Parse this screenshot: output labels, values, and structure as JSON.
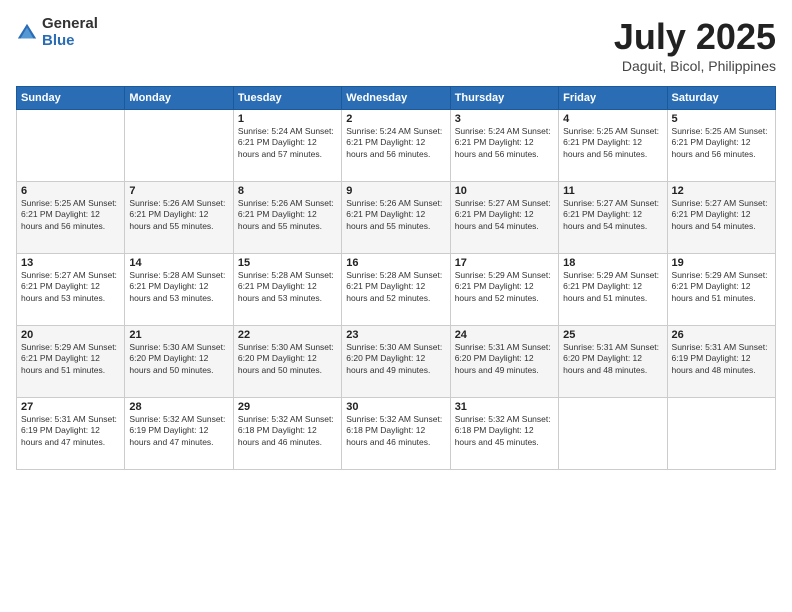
{
  "logo": {
    "general": "General",
    "blue": "Blue"
  },
  "title": "July 2025",
  "location": "Daguit, Bicol, Philippines",
  "days_header": [
    "Sunday",
    "Monday",
    "Tuesday",
    "Wednesday",
    "Thursday",
    "Friday",
    "Saturday"
  ],
  "weeks": [
    [
      {
        "day": "",
        "content": ""
      },
      {
        "day": "",
        "content": ""
      },
      {
        "day": "1",
        "content": "Sunrise: 5:24 AM\nSunset: 6:21 PM\nDaylight: 12 hours and 57 minutes."
      },
      {
        "day": "2",
        "content": "Sunrise: 5:24 AM\nSunset: 6:21 PM\nDaylight: 12 hours and 56 minutes."
      },
      {
        "day": "3",
        "content": "Sunrise: 5:24 AM\nSunset: 6:21 PM\nDaylight: 12 hours and 56 minutes."
      },
      {
        "day": "4",
        "content": "Sunrise: 5:25 AM\nSunset: 6:21 PM\nDaylight: 12 hours and 56 minutes."
      },
      {
        "day": "5",
        "content": "Sunrise: 5:25 AM\nSunset: 6:21 PM\nDaylight: 12 hours and 56 minutes."
      }
    ],
    [
      {
        "day": "6",
        "content": "Sunrise: 5:25 AM\nSunset: 6:21 PM\nDaylight: 12 hours and 56 minutes."
      },
      {
        "day": "7",
        "content": "Sunrise: 5:26 AM\nSunset: 6:21 PM\nDaylight: 12 hours and 55 minutes."
      },
      {
        "day": "8",
        "content": "Sunrise: 5:26 AM\nSunset: 6:21 PM\nDaylight: 12 hours and 55 minutes."
      },
      {
        "day": "9",
        "content": "Sunrise: 5:26 AM\nSunset: 6:21 PM\nDaylight: 12 hours and 55 minutes."
      },
      {
        "day": "10",
        "content": "Sunrise: 5:27 AM\nSunset: 6:21 PM\nDaylight: 12 hours and 54 minutes."
      },
      {
        "day": "11",
        "content": "Sunrise: 5:27 AM\nSunset: 6:21 PM\nDaylight: 12 hours and 54 minutes."
      },
      {
        "day": "12",
        "content": "Sunrise: 5:27 AM\nSunset: 6:21 PM\nDaylight: 12 hours and 54 minutes."
      }
    ],
    [
      {
        "day": "13",
        "content": "Sunrise: 5:27 AM\nSunset: 6:21 PM\nDaylight: 12 hours and 53 minutes."
      },
      {
        "day": "14",
        "content": "Sunrise: 5:28 AM\nSunset: 6:21 PM\nDaylight: 12 hours and 53 minutes."
      },
      {
        "day": "15",
        "content": "Sunrise: 5:28 AM\nSunset: 6:21 PM\nDaylight: 12 hours and 53 minutes."
      },
      {
        "day": "16",
        "content": "Sunrise: 5:28 AM\nSunset: 6:21 PM\nDaylight: 12 hours and 52 minutes."
      },
      {
        "day": "17",
        "content": "Sunrise: 5:29 AM\nSunset: 6:21 PM\nDaylight: 12 hours and 52 minutes."
      },
      {
        "day": "18",
        "content": "Sunrise: 5:29 AM\nSunset: 6:21 PM\nDaylight: 12 hours and 51 minutes."
      },
      {
        "day": "19",
        "content": "Sunrise: 5:29 AM\nSunset: 6:21 PM\nDaylight: 12 hours and 51 minutes."
      }
    ],
    [
      {
        "day": "20",
        "content": "Sunrise: 5:29 AM\nSunset: 6:21 PM\nDaylight: 12 hours and 51 minutes."
      },
      {
        "day": "21",
        "content": "Sunrise: 5:30 AM\nSunset: 6:20 PM\nDaylight: 12 hours and 50 minutes."
      },
      {
        "day": "22",
        "content": "Sunrise: 5:30 AM\nSunset: 6:20 PM\nDaylight: 12 hours and 50 minutes."
      },
      {
        "day": "23",
        "content": "Sunrise: 5:30 AM\nSunset: 6:20 PM\nDaylight: 12 hours and 49 minutes."
      },
      {
        "day": "24",
        "content": "Sunrise: 5:31 AM\nSunset: 6:20 PM\nDaylight: 12 hours and 49 minutes."
      },
      {
        "day": "25",
        "content": "Sunrise: 5:31 AM\nSunset: 6:20 PM\nDaylight: 12 hours and 48 minutes."
      },
      {
        "day": "26",
        "content": "Sunrise: 5:31 AM\nSunset: 6:19 PM\nDaylight: 12 hours and 48 minutes."
      }
    ],
    [
      {
        "day": "27",
        "content": "Sunrise: 5:31 AM\nSunset: 6:19 PM\nDaylight: 12 hours and 47 minutes."
      },
      {
        "day": "28",
        "content": "Sunrise: 5:32 AM\nSunset: 6:19 PM\nDaylight: 12 hours and 47 minutes."
      },
      {
        "day": "29",
        "content": "Sunrise: 5:32 AM\nSunset: 6:18 PM\nDaylight: 12 hours and 46 minutes."
      },
      {
        "day": "30",
        "content": "Sunrise: 5:32 AM\nSunset: 6:18 PM\nDaylight: 12 hours and 46 minutes."
      },
      {
        "day": "31",
        "content": "Sunrise: 5:32 AM\nSunset: 6:18 PM\nDaylight: 12 hours and 45 minutes."
      },
      {
        "day": "",
        "content": ""
      },
      {
        "day": "",
        "content": ""
      }
    ]
  ]
}
